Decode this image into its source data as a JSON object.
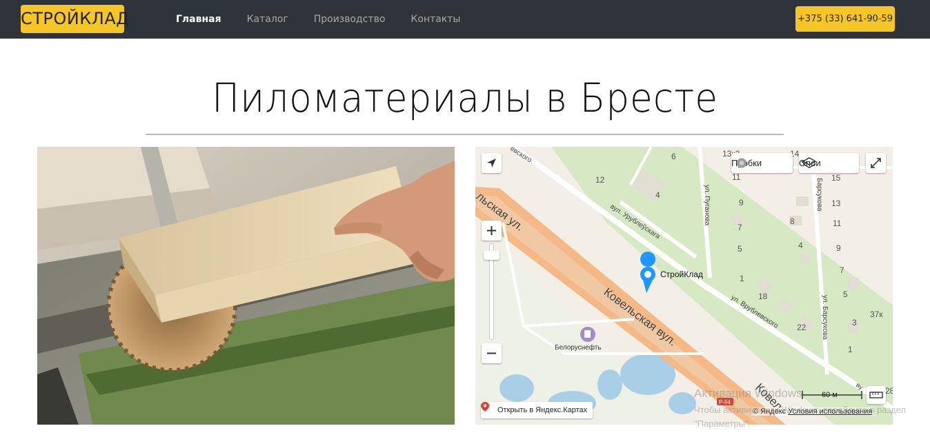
{
  "header": {
    "logo_text": "СТРОЙКЛАД",
    "nav": [
      {
        "label": "Главная",
        "active": true
      },
      {
        "label": "Каталог",
        "active": false
      },
      {
        "label": "Производство",
        "active": false
      },
      {
        "label": "Контакты",
        "active": false
      }
    ],
    "phone": "+375 (33) 641-90-59",
    "colors": {
      "bar": "#2f343a",
      "accent": "#f6c526"
    }
  },
  "page_title": "Пиломатериалы в Бресте",
  "photo": {
    "icon": "circular-saw-photo"
  },
  "map": {
    "controls": {
      "traffic_label": "Пробки",
      "layers_label": "Слои",
      "open_label": "Открыть в Яндекс.Картах",
      "scale_label": "60 м"
    },
    "marker_label": "СтройКлад",
    "poi_label": "Белоруснефть",
    "streets": {
      "kovel_ru": "Ковельская ул.",
      "kovel_by": "Ковельская вул.",
      "kovel_end": "Ковел",
      "kovel_top": "льская ул.",
      "vrublevskogo": "ул. Врублевского",
      "urublevskaga": "вул. Урублеўскага",
      "puganova": "ул. Пуганова",
      "barsukova": "ул. Барсукова",
      "barsukova_by": "Барсукова",
      "vrublevskogo_top": "евского",
      "road_badge": "Р-94",
      "edge_vu": "ву"
    },
    "house_numbers": [
      "6",
      "12",
      "4",
      "13к2",
      "14",
      "11",
      "9",
      "7",
      "5",
      "1",
      "15",
      "13",
      "11",
      "9",
      "7",
      "8",
      "4",
      "5",
      "18",
      "22",
      "3",
      "37к",
      "1",
      "28"
    ],
    "copyright_prefix": "© Яндекс",
    "copyright_link": "Условия использования"
  },
  "watermark": {
    "line1": "Активация Windows",
    "line2": "Чтобы активировать Windows, перейдите в раздел \"Параметры\"."
  }
}
